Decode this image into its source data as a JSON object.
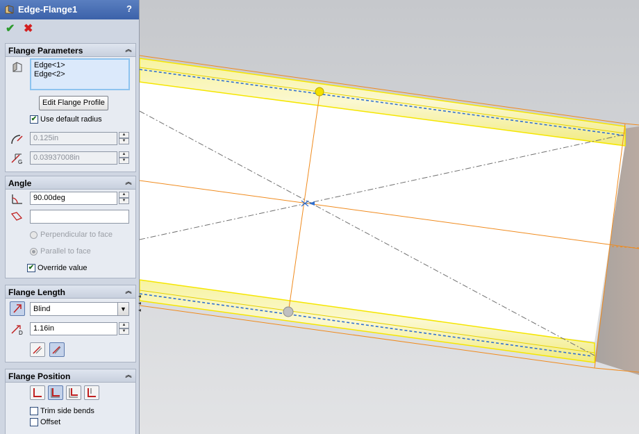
{
  "title_bar": {
    "title": "Edge-Flange1",
    "help": "?"
  },
  "actions": {
    "ok_symbol": "✔",
    "cancel_symbol": "✖"
  },
  "flange_parameters": {
    "header": "Flange Parameters",
    "edges": [
      "Edge<1>",
      "Edge<2>"
    ],
    "edit_profile_label": "Edit Flange Profile",
    "use_default_radius_label": "Use default radius",
    "use_default_radius_checked": true,
    "bend_radius": "0.125in",
    "gap_distance": "0.03937008in"
  },
  "angle": {
    "header": "Angle",
    "value": "90.00deg",
    "face_select_value": "",
    "perpendicular_label": "Perpendicular to face",
    "parallel_label": "Parallel to face",
    "override_label": "Override value",
    "override_checked": true
  },
  "flange_length": {
    "header": "Flange Length",
    "end_condition": "Blind",
    "length": "1.16in"
  },
  "flange_position": {
    "header": "Flange Position",
    "trim_side_bends_label": "Trim side bends",
    "trim_side_bends_checked": false,
    "offset_label": "Offset",
    "offset_checked": false
  },
  "colors": {
    "title_bar": "#3b61a9",
    "panel": "#cfd6e2",
    "flange_highlight": "#f5e600",
    "preview_outline": "#f08a1c",
    "selected_edge": "#2f6fd0"
  }
}
